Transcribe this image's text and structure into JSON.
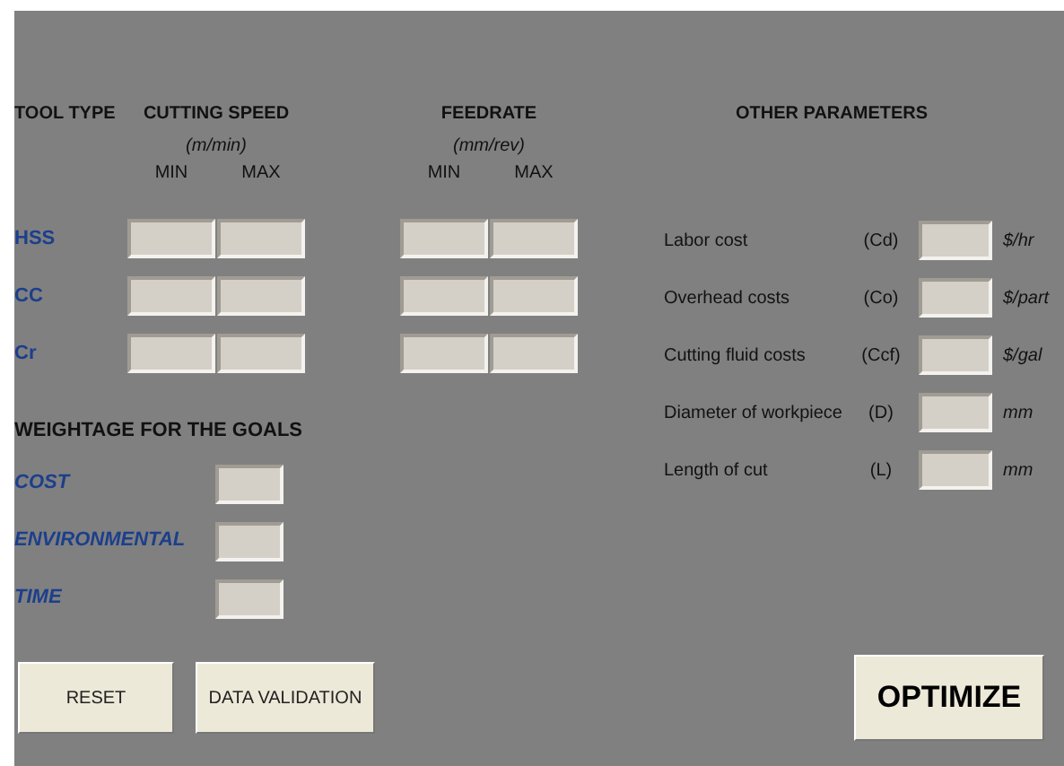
{
  "headers": {
    "tool_type": "TOOL TYPE",
    "cutting_speed": {
      "title": "CUTTING SPEED",
      "unit": "(m/min)",
      "min": "MIN",
      "max": "MAX"
    },
    "feedrate": {
      "title": "FEEDRATE",
      "unit": "(mm/rev)",
      "min": "MIN",
      "max": "MAX"
    },
    "other": "OTHER PARAMETERS"
  },
  "tools": [
    {
      "label": "HSS"
    },
    {
      "label": "CC"
    },
    {
      "label": "Cr"
    }
  ],
  "weightage": {
    "title": "WEIGHTAGE FOR THE GOALS",
    "goals": [
      {
        "label": "COST"
      },
      {
        "label": "ENVIRONMENTAL"
      },
      {
        "label": "TIME"
      }
    ]
  },
  "parameters": [
    {
      "label": "Labor cost",
      "code": "(Cd)",
      "unit": "$/hr"
    },
    {
      "label": "Overhead costs",
      "code": "(Co)",
      "unit": "$/part"
    },
    {
      "label": "Cutting fluid costs",
      "code": "(Ccf)",
      "unit": "$/gal"
    },
    {
      "label": "Diameter of workpiece",
      "code": "(D)",
      "unit": "mm"
    },
    {
      "label": "Length of cut",
      "code": "(L)",
      "unit": "mm"
    }
  ],
  "buttons": [
    {
      "label": "RESET",
      "kind": "normal"
    },
    {
      "label": "DATA VALIDATION",
      "kind": "normal"
    },
    {
      "label": "OPTIMIZE",
      "kind": "primary"
    }
  ]
}
